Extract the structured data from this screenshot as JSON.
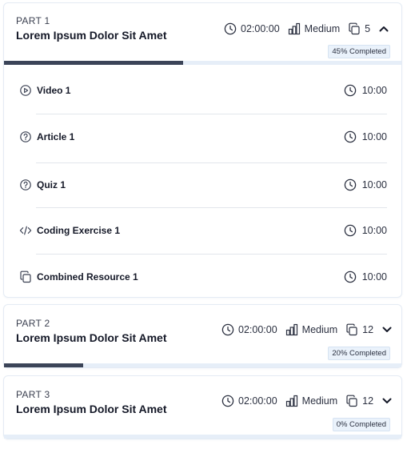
{
  "parts": [
    {
      "label": "PART 1",
      "title": "Lorem Ipsum Dolor Sit Amet",
      "duration": "02:00:00",
      "difficulty": "Medium",
      "resources": "5",
      "completed_label": "45% Completed",
      "progress": 0.45,
      "expanded": true,
      "items": [
        {
          "type": "video",
          "icon": "play-circle-icon",
          "label": "Video 1",
          "duration": "10:00"
        },
        {
          "type": "article",
          "icon": "question-circle-icon",
          "label": "Article 1",
          "duration": "10:00"
        },
        {
          "type": "quiz",
          "icon": "question-circle-icon",
          "label": "Quiz 1",
          "duration": "10:00"
        },
        {
          "type": "coding",
          "icon": "code-icon",
          "label": "Coding Exercise 1",
          "duration": "10:00"
        },
        {
          "type": "combined",
          "icon": "copy-icon",
          "label": "Combined Resource 1",
          "duration": "10:00"
        }
      ]
    },
    {
      "label": "PART 2",
      "title": "Lorem Ipsum Dolor Sit Amet",
      "duration": "02:00:00",
      "difficulty": "Medium",
      "resources": "12",
      "completed_label": "20% Completed",
      "progress": 0.2,
      "expanded": false
    },
    {
      "label": "PART 3",
      "title": "Lorem Ipsum Dolor Sit Amet",
      "duration": "02:00:00",
      "difficulty": "Medium",
      "resources": "12",
      "completed_label": "0% Completed",
      "progress": 0,
      "expanded": false
    }
  ],
  "colors": {
    "progress_fill": "#3b4458",
    "progress_track": "#e6eef8",
    "badge_bg": "#eaf2fb",
    "card_border": "#e4ebf4"
  }
}
